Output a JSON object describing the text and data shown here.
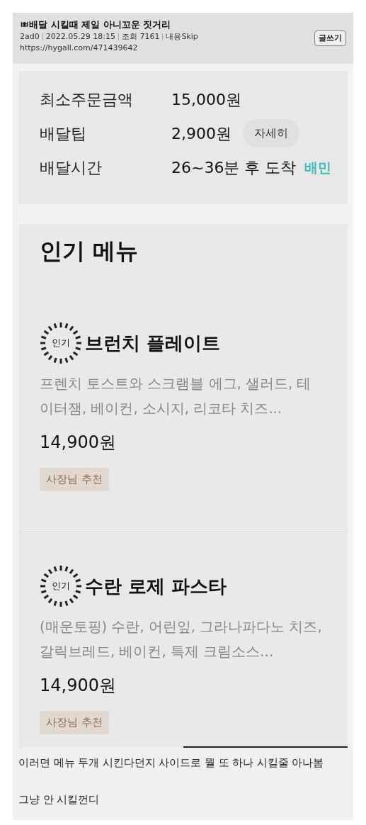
{
  "post": {
    "title": "ㅃ배달 시킬때 제일 아니꼬운 짓거리",
    "meta": [
      "2ad0",
      "2022.05.29 18:15",
      "조회 7161",
      "내용Skip"
    ],
    "url": "https://hygall.com/471439642",
    "write_button": "글쓰기"
  },
  "delivery_info": {
    "rows": [
      {
        "label": "최소주문금액",
        "value": "15,000원"
      },
      {
        "label": "배달팁",
        "value": "2,900원",
        "button": "자세히"
      },
      {
        "label": "배달시간",
        "value": "26~36분 후 도착",
        "tag": "배민"
      }
    ]
  },
  "popular_menu": {
    "title": "인기 메뉴",
    "items": [
      {
        "badge": "인기",
        "name": "브런치 플레이트",
        "description": "프렌치 토스트와 스크램블 에그, 샐러드, 테이터잼, 베이컨, 소시지, 리코타 치즈...",
        "price": "14,900원",
        "tag": "사장님 추천"
      },
      {
        "badge": "인기",
        "name": "수란 로제 파스타",
        "description": "(매운토핑) 수란, 어린잎, 그라나파다노 치즈, 갈릭브레드, 베이컨, 특제 크림소스…",
        "price": "14,900원",
        "tag": "사장님 추천"
      }
    ]
  },
  "body": [
    "이러면 메뉴 두개 시킨다던지 사이드로 뭘 또 하나 시킬줄 아나봄",
    "그냥 안 시킬껀디"
  ]
}
